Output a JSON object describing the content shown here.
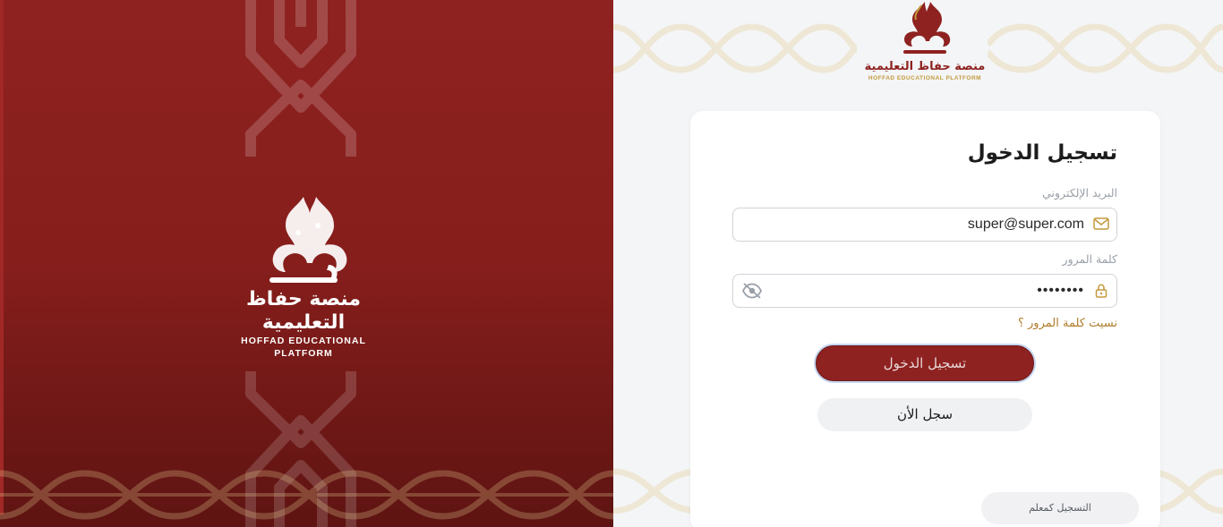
{
  "brand": {
    "name_ar": "منصة حفاظ التعليمية",
    "name_en": "HOFFAD EDUCATIONAL PLATFORM",
    "primary_color": "#8e2220",
    "accent_color": "#c39a3c"
  },
  "login": {
    "title": "تسجيل الدخول",
    "email_label": "البريد الإلكتروني",
    "email_value": "super@super.com",
    "password_label": "كلمة المرور",
    "password_value": "••••••••",
    "forgot_link": "نسيت كلمة المرور ؟",
    "submit_label": "تسجيل الدخول",
    "register_label": "سجل الأن",
    "register_teacher_label": "التسجيل كمعلم"
  },
  "icons": {
    "email": "mail-icon",
    "password": "lock-icon",
    "toggle_visibility": "eye-slash-icon"
  }
}
